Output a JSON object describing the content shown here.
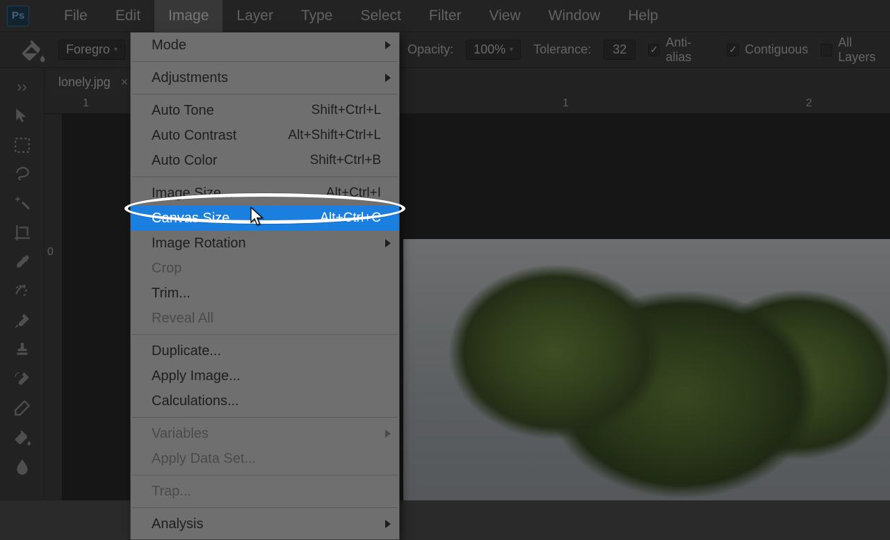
{
  "app": {
    "logo_text": "Ps"
  },
  "menubar": {
    "items": [
      "File",
      "Edit",
      "Image",
      "Layer",
      "Type",
      "Select",
      "Filter",
      "View",
      "Window",
      "Help"
    ],
    "open_index": 2
  },
  "options_bar": {
    "mode_label": "Foregro",
    "opacity_label": "Opacity:",
    "opacity_value": "100%",
    "tolerance_label": "Tolerance:",
    "tolerance_value": "32",
    "antialias_label": "Anti-alias",
    "contiguous_label": "Contiguous",
    "all_layers_label": "All Layers"
  },
  "document": {
    "tab_label": "lonely.jpg",
    "tab_close": "×"
  },
  "rulers": {
    "h": [
      "1",
      "1",
      "2"
    ],
    "h_pos": [
      55,
      745,
      1095
    ],
    "v": [
      "0"
    ],
    "v_pos": [
      190
    ]
  },
  "menu": {
    "groups": [
      [
        {
          "label": "Mode",
          "submenu": true
        }
      ],
      [
        {
          "label": "Adjustments",
          "submenu": true
        }
      ],
      [
        {
          "label": "Auto Tone",
          "shortcut": "Shift+Ctrl+L"
        },
        {
          "label": "Auto Contrast",
          "shortcut": "Alt+Shift+Ctrl+L"
        },
        {
          "label": "Auto Color",
          "shortcut": "Shift+Ctrl+B"
        }
      ],
      [
        {
          "label": "Image Size...",
          "shortcut": "Alt+Ctrl+I"
        },
        {
          "label": "Canvas Size...",
          "shortcut": "Alt+Ctrl+C",
          "highlight": true
        },
        {
          "label": "Image Rotation",
          "submenu": true
        },
        {
          "label": "Crop",
          "disabled": true
        },
        {
          "label": "Trim..."
        },
        {
          "label": "Reveal All",
          "disabled": true
        }
      ],
      [
        {
          "label": "Duplicate..."
        },
        {
          "label": "Apply Image..."
        },
        {
          "label": "Calculations..."
        }
      ],
      [
        {
          "label": "Variables",
          "submenu": true,
          "disabled": true
        },
        {
          "label": "Apply Data Set...",
          "disabled": true
        }
      ],
      [
        {
          "label": "Trap...",
          "disabled": true
        }
      ],
      [
        {
          "label": "Analysis",
          "submenu": true
        }
      ]
    ]
  }
}
